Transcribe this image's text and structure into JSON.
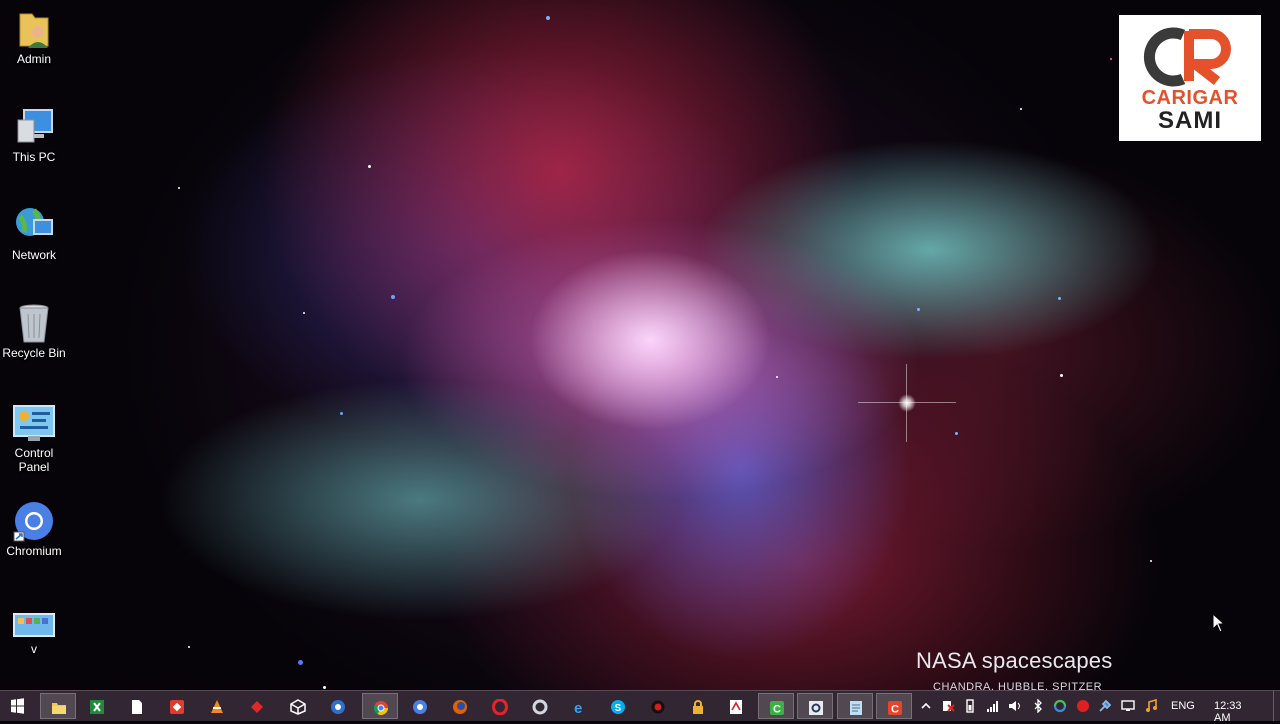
{
  "desktop": {
    "icons": [
      {
        "label": "Admin",
        "icon": "user-folder-icon"
      },
      {
        "label": "This PC",
        "icon": "computer-icon"
      },
      {
        "label": "Network",
        "icon": "network-icon"
      },
      {
        "label": "Recycle Bin",
        "icon": "recycle-bin-icon"
      },
      {
        "label": "Control\nPanel",
        "icon": "control-panel-icon"
      },
      {
        "label": "Chromium",
        "icon": "chromium-icon"
      },
      {
        "label": "v",
        "icon": "application-icon"
      }
    ]
  },
  "wallpaper": {
    "credit_title": "NASA spacescapes",
    "credit_subtitle": "CHANDRA, HUBBLE, SPITZER"
  },
  "logo": {
    "line1": "CARIGAR",
    "line2": "SAMI",
    "text_color": "#e4512a",
    "mark_letters": "CR"
  },
  "taskbar": {
    "start_icon": "windows-start-icon",
    "pinned": [
      {
        "name": "file-explorer-icon",
        "active": true
      },
      {
        "name": "excel-icon",
        "active": false
      },
      {
        "name": "document-icon",
        "active": false
      },
      {
        "name": "anydesk-icon",
        "active": false
      },
      {
        "name": "vlc-icon",
        "active": false
      },
      {
        "name": "red-app-icon",
        "active": false
      },
      {
        "name": "virtualbox-icon",
        "active": false
      },
      {
        "name": "remote-desktop-icon",
        "active": false
      },
      {
        "name": "chrome-icon",
        "active": true
      },
      {
        "name": "chromium-icon",
        "active": false
      },
      {
        "name": "firefox-icon",
        "active": false
      },
      {
        "name": "opera-icon",
        "active": false
      },
      {
        "name": "sync-icon",
        "active": false
      },
      {
        "name": "internet-explorer-icon",
        "active": false
      },
      {
        "name": "skype-icon",
        "active": false
      },
      {
        "name": "record-icon",
        "active": false
      },
      {
        "name": "lock-app-icon",
        "active": false
      },
      {
        "name": "pdf-icon",
        "active": false
      },
      {
        "name": "camtasia-icon",
        "active": true
      },
      {
        "name": "settings-app-icon",
        "active": true
      },
      {
        "name": "notepad-icon",
        "active": true
      },
      {
        "name": "recorder-icon",
        "active": true
      }
    ],
    "tray": {
      "icons": [
        "show-hidden-icons-chevron",
        "flag-icon",
        "battery-icon",
        "signal-icon",
        "volume-icon",
        "bluetooth-icon",
        "sync-tray-icon",
        "red-tray-icon",
        "tool-icon",
        "display-icon",
        "music-icon"
      ],
      "language": "ENG",
      "time": "12:33 AM"
    },
    "colors": {
      "background": "#342834",
      "active_highlight": "#ffffff29"
    }
  }
}
